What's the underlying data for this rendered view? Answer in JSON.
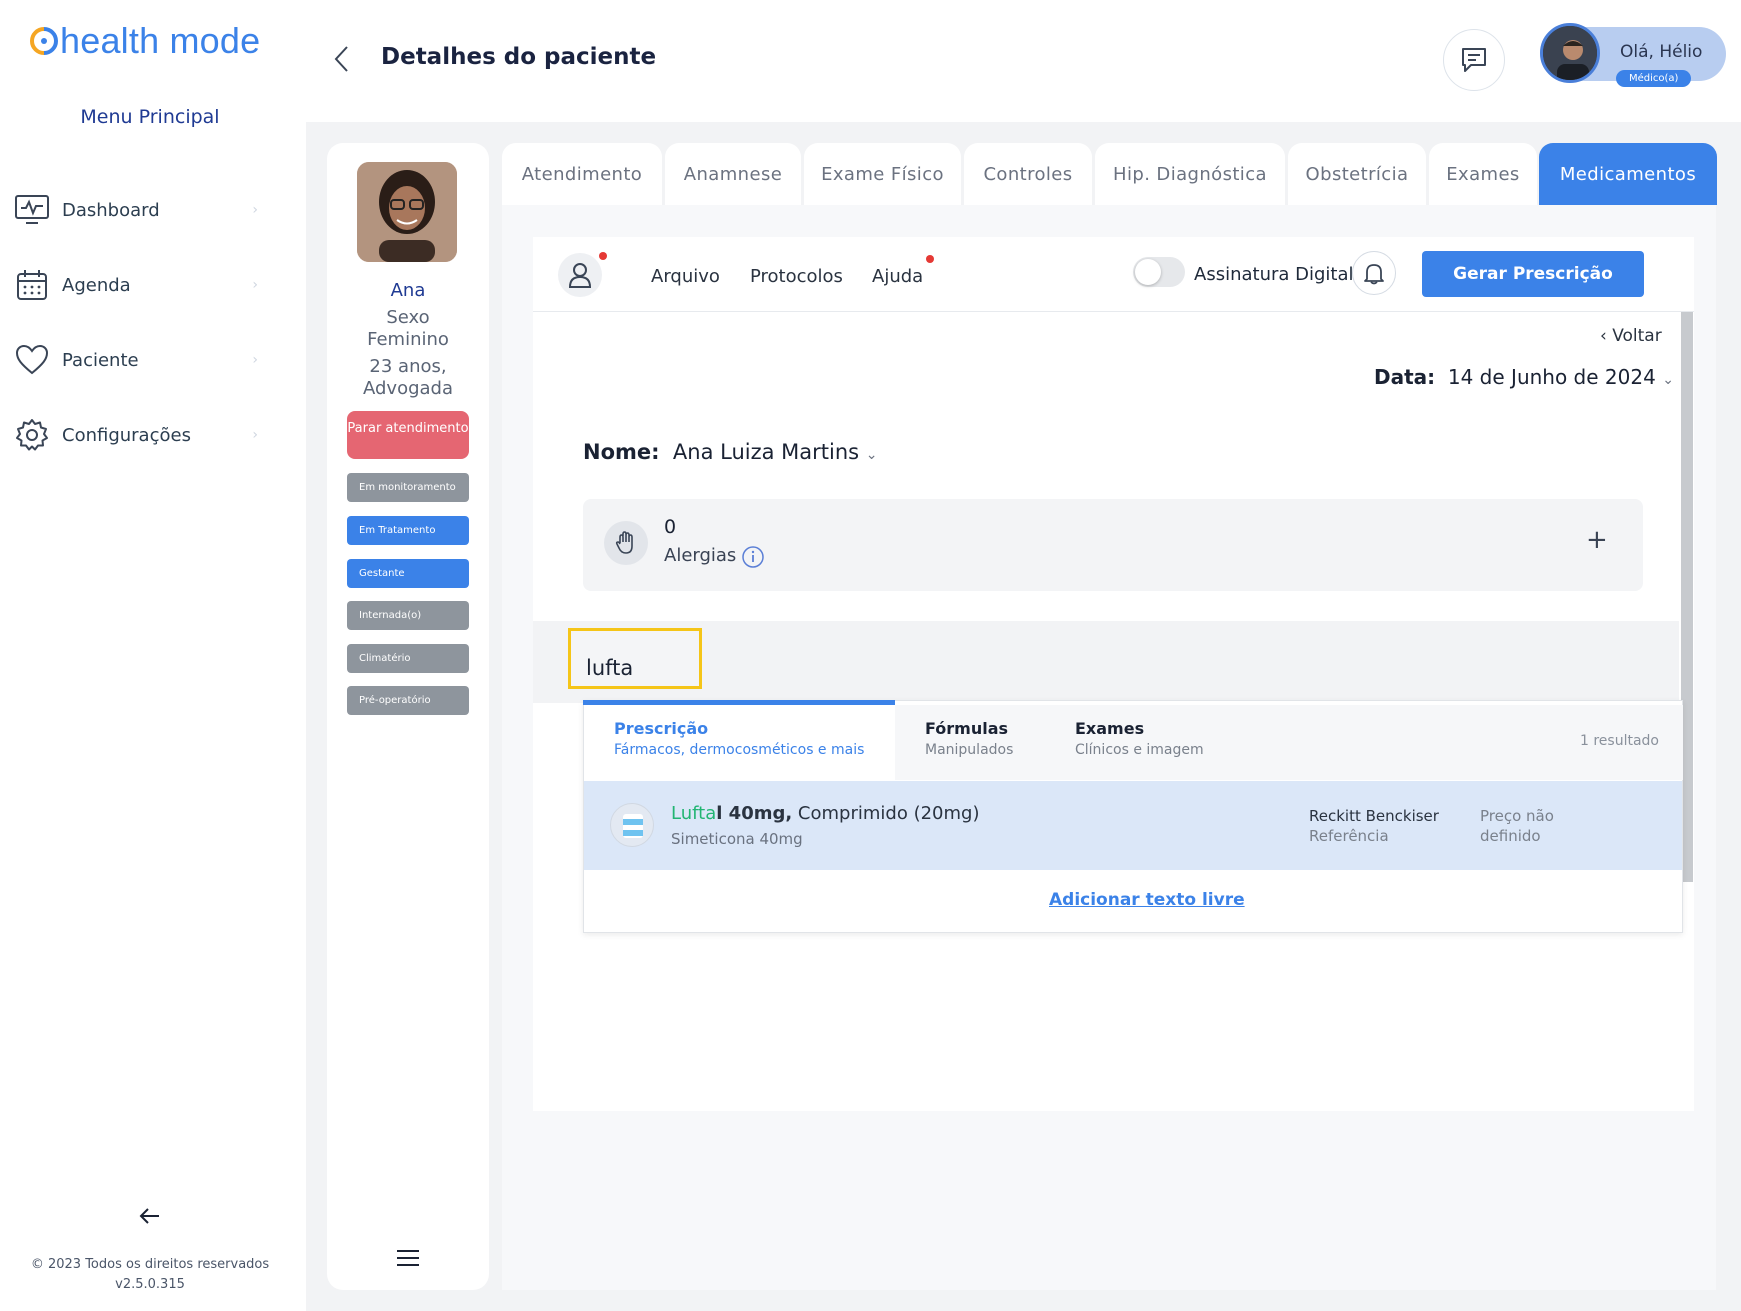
{
  "app": {
    "logo_text": "health mode"
  },
  "sidebar": {
    "menu_title": "Menu Principal",
    "items": [
      {
        "label": "Dashboard",
        "icon": "monitor-icon"
      },
      {
        "label": "Agenda",
        "icon": "calendar-icon"
      },
      {
        "label": "Paciente",
        "icon": "heart-icon"
      },
      {
        "label": "Configurações",
        "icon": "gear-icon"
      }
    ],
    "copyright": "© 2023 Todos os direitos reservados",
    "version": "v2.5.0.315"
  },
  "header": {
    "title": "Detalhes do paciente",
    "greeting": "Olá, Hélio",
    "role": "Médico(a)"
  },
  "patient": {
    "name": "Ana",
    "sex": "Sexo",
    "sex_value": "Feminino",
    "age": "23 anos,",
    "occupation": "Advogada",
    "stop_button": "Parar atendimento",
    "tags": [
      "Em monitoramento",
      "Em Tratamento",
      "Gestante",
      "Internada(o)",
      "Climatério",
      "Pré-operatório"
    ]
  },
  "tabs": [
    "Atendimento",
    "Anamnese",
    "Exame Físico",
    "Controles",
    "Hip. Diagnóstica",
    "Obstetrícia",
    "Exames",
    "Medicamentos"
  ],
  "toolbar": {
    "arquivo": "Arquivo",
    "protocolos": "Protocolos",
    "ajuda": "Ajuda",
    "signature": "Assinatura Digital",
    "generate": "Gerar Prescrição"
  },
  "prescription": {
    "back": "Voltar",
    "date_label": "Data:",
    "date_value": "14 de Junho de 2024",
    "name_label": "Nome:",
    "name_value": "Ana Luiza Martins",
    "allergy_count": "0",
    "allergy_label": "Alergias",
    "search_value": "lufta"
  },
  "dropdown": {
    "tabs": [
      {
        "title": "Prescrição",
        "subtitle": "Fármacos, dermocosméticos e mais"
      },
      {
        "title": "Fórmulas",
        "subtitle": "Manipulados"
      },
      {
        "title": "Exames",
        "subtitle": "Clínicos e imagem"
      }
    ],
    "result_count": "1 resultado",
    "result": {
      "name_highlight": "Lufta",
      "name_rest_bold": "l 40mg,",
      "name_rest": " Comprimido (20mg)",
      "substance": "Simeticona 40mg",
      "lab": "Reckitt Benckiser",
      "lab_type": "Referência",
      "price_line1": "Preço não",
      "price_line2": "definido"
    },
    "free_text": "Adicionar texto livre"
  },
  "colors": {
    "accent": "#3b82e8",
    "danger": "#e56672",
    "highlight": "#f5c518",
    "match": "#22b573"
  }
}
